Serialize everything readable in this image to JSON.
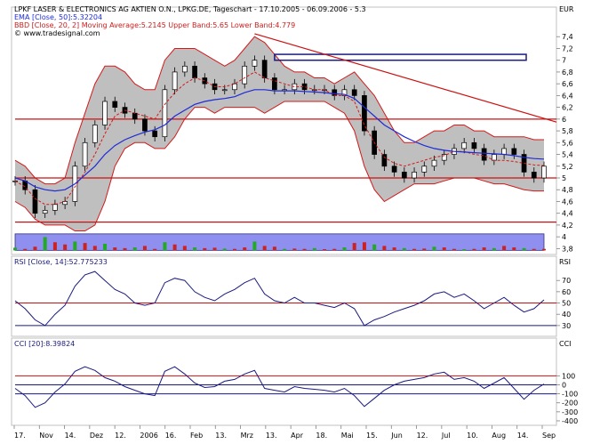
{
  "header": {
    "title": "LPKF LASER & ELECTRONICS AG AKTIEN O.N., LPKG.DE, Tageschart - 17.10.2005 - 06.09.2006 - 5.3",
    "currency": "EUR",
    "ema_legend": "EMA [Close, 50]:5.32204",
    "bb_legend": "BBD [Close, 20, 2] Moving Average:5.2145 Upper Band:5.65 Lower Band:4.779",
    "source": "© www.tradesignal.com",
    "rsi_legend": "RSI [Close, 14]:52.775233",
    "rsi_tag": "RSI",
    "cci_legend": "CCI [20]:8.39824",
    "cci_tag": "CCI"
  },
  "colors": {
    "candle_up": "#ffffff",
    "candle_down": "#000000",
    "ema": "#1f2bd6",
    "bb_fill": "#b8b8b8",
    "bb_band": "#d21a1a",
    "moving_average": "#d21a1a",
    "support_line": "#cc1111",
    "volume_bg": "#8f8ff0",
    "indicator_line": "#1a1a80",
    "ref_line": "#cc1111"
  },
  "chart_data": [
    {
      "type": "candlestick",
      "panel": "price",
      "ylim": [
        3.7,
        7.6
      ],
      "y_ticks": [
        "3,8",
        "4",
        "4,2",
        "4,4",
        "4,6",
        "4,8",
        "5",
        "5,2",
        "5,4",
        "5,6",
        "5,8",
        "6",
        "6,2",
        "6,4",
        "6,6",
        "6,8",
        "7",
        "7,2",
        "7,4"
      ],
      "x_ticks": [
        "17.",
        "Nov",
        "14.",
        "Dez",
        "12.",
        "2006",
        "16.",
        "Feb",
        "13.",
        "Mrz",
        "13.",
        "Apr",
        "18.",
        "Mai",
        "15.",
        "Jun",
        "12.",
        "Jul",
        "10.",
        "Aug",
        "14.",
        "Sep"
      ],
      "close_series": [
        4.95,
        4.8,
        4.4,
        4.45,
        4.55,
        4.6,
        5.2,
        5.6,
        5.9,
        6.3,
        6.2,
        6.1,
        6.0,
        5.8,
        5.7,
        6.5,
        6.8,
        6.9,
        6.7,
        6.6,
        6.5,
        6.5,
        6.6,
        6.9,
        7.0,
        6.7,
        6.5,
        6.5,
        6.6,
        6.5,
        6.5,
        6.5,
        6.4,
        6.5,
        6.4,
        5.8,
        5.4,
        5.2,
        5.1,
        5.0,
        5.1,
        5.2,
        5.3,
        5.4,
        5.5,
        5.6,
        5.5,
        5.3,
        5.4,
        5.5,
        5.4,
        5.1,
        5.0,
        5.2
      ],
      "ema_50": [
        5.0,
        4.95,
        4.85,
        4.8,
        4.78,
        4.8,
        4.9,
        5.05,
        5.2,
        5.4,
        5.55,
        5.65,
        5.72,
        5.78,
        5.82,
        5.9,
        6.05,
        6.15,
        6.25,
        6.3,
        6.33,
        6.35,
        6.38,
        6.45,
        6.5,
        6.5,
        6.48,
        6.48,
        6.48,
        6.47,
        6.46,
        6.45,
        6.43,
        6.42,
        6.35,
        6.2,
        6.05,
        5.9,
        5.8,
        5.7,
        5.62,
        5.55,
        5.5,
        5.47,
        5.45,
        5.44,
        5.43,
        5.42,
        5.41,
        5.4,
        5.38,
        5.35,
        5.33,
        5.32
      ],
      "bollinger_upper": [
        5.3,
        5.2,
        5.0,
        4.9,
        4.9,
        5.0,
        5.6,
        6.1,
        6.6,
        6.9,
        6.9,
        6.8,
        6.6,
        6.5,
        6.5,
        7.0,
        7.2,
        7.2,
        7.2,
        7.1,
        7.0,
        6.9,
        7.0,
        7.2,
        7.4,
        7.3,
        7.1,
        6.9,
        6.8,
        6.8,
        6.7,
        6.7,
        6.6,
        6.7,
        6.8,
        6.6,
        6.4,
        6.1,
        5.8,
        5.6,
        5.6,
        5.7,
        5.8,
        5.8,
        5.9,
        5.9,
        5.8,
        5.8,
        5.7,
        5.7,
        5.7,
        5.7,
        5.65,
        5.65
      ],
      "bollinger_lower": [
        4.6,
        4.5,
        4.3,
        4.2,
        4.2,
        4.2,
        4.1,
        4.1,
        4.2,
        4.6,
        5.2,
        5.5,
        5.6,
        5.6,
        5.5,
        5.5,
        5.7,
        6.0,
        6.2,
        6.2,
        6.1,
        6.2,
        6.2,
        6.2,
        6.2,
        6.1,
        6.2,
        6.3,
        6.3,
        6.3,
        6.3,
        6.3,
        6.2,
        6.1,
        5.8,
        5.2,
        4.8,
        4.6,
        4.7,
        4.8,
        4.9,
        4.9,
        4.9,
        4.95,
        5.0,
        5.0,
        5.0,
        4.95,
        4.9,
        4.9,
        4.85,
        4.8,
        4.78,
        4.78
      ],
      "moving_average_20": [
        4.95,
        4.85,
        4.65,
        4.55,
        4.55,
        4.6,
        4.85,
        5.1,
        5.4,
        5.75,
        6.05,
        6.15,
        6.1,
        6.05,
        6.0,
        6.25,
        6.45,
        6.6,
        6.7,
        6.65,
        6.55,
        6.55,
        6.6,
        6.7,
        6.8,
        6.7,
        6.65,
        6.6,
        6.55,
        6.55,
        6.5,
        6.5,
        6.4,
        6.4,
        6.3,
        5.9,
        5.6,
        5.35,
        5.25,
        5.2,
        5.25,
        5.3,
        5.35,
        5.38,
        5.45,
        5.45,
        5.4,
        5.38,
        5.3,
        5.3,
        5.28,
        5.25,
        5.22,
        5.21
      ],
      "horizontal_lines": [
        6.0,
        5.0,
        4.25
      ],
      "resistance_box": [
        7.0,
        7.1
      ],
      "trendline": [
        [
          7.45,
          5.95
        ]
      ]
    },
    {
      "type": "bar",
      "panel": "volume",
      "ylim": [
        0,
        1
      ],
      "values": [
        0.18,
        0.1,
        0.25,
        0.9,
        0.55,
        0.4,
        0.6,
        0.5,
        0.3,
        0.45,
        0.2,
        0.15,
        0.2,
        0.3,
        0.1,
        0.55,
        0.4,
        0.3,
        0.2,
        0.15,
        0.18,
        0.12,
        0.1,
        0.2,
        0.6,
        0.3,
        0.25,
        0.1,
        0.12,
        0.1,
        0.15,
        0.08,
        0.1,
        0.2,
        0.5,
        0.55,
        0.4,
        0.3,
        0.2,
        0.15,
        0.1,
        0.12,
        0.25,
        0.2,
        0.1,
        0.08,
        0.1,
        0.2,
        0.15,
        0.3,
        0.2,
        0.15,
        0.1,
        0.1
      ]
    },
    {
      "type": "line",
      "panel": "rsi",
      "ylim": [
        22,
        82
      ],
      "y_ticks": [
        30,
        40,
        50,
        60,
        70
      ],
      "ref_lines": [
        50,
        30
      ],
      "values": [
        52,
        45,
        35,
        30,
        40,
        48,
        65,
        75,
        78,
        70,
        62,
        58,
        50,
        48,
        50,
        68,
        72,
        70,
        60,
        55,
        52,
        58,
        62,
        68,
        72,
        58,
        52,
        50,
        55,
        50,
        50,
        48,
        46,
        50,
        45,
        30,
        35,
        38,
        42,
        45,
        48,
        52,
        58,
        60,
        55,
        58,
        52,
        45,
        50,
        55,
        48,
        42,
        45,
        52.8
      ]
    },
    {
      "type": "line",
      "panel": "cci",
      "ylim": [
        -430,
        400
      ],
      "y_ticks": [
        -400,
        -300,
        -200,
        -100,
        0,
        100
      ],
      "ref_lines": [
        100,
        0,
        -100
      ],
      "values": [
        -40,
        -120,
        -250,
        -200,
        -80,
        10,
        150,
        200,
        160,
        80,
        40,
        -20,
        -60,
        -100,
        -120,
        150,
        200,
        120,
        20,
        -30,
        -20,
        40,
        60,
        120,
        160,
        -40,
        -60,
        -80,
        -20,
        -40,
        -50,
        -60,
        -80,
        -40,
        -120,
        -240,
        -150,
        -60,
        0,
        40,
        60,
        80,
        120,
        140,
        60,
        80,
        40,
        -40,
        20,
        80,
        -40,
        -160,
        -60,
        8.4
      ]
    }
  ]
}
